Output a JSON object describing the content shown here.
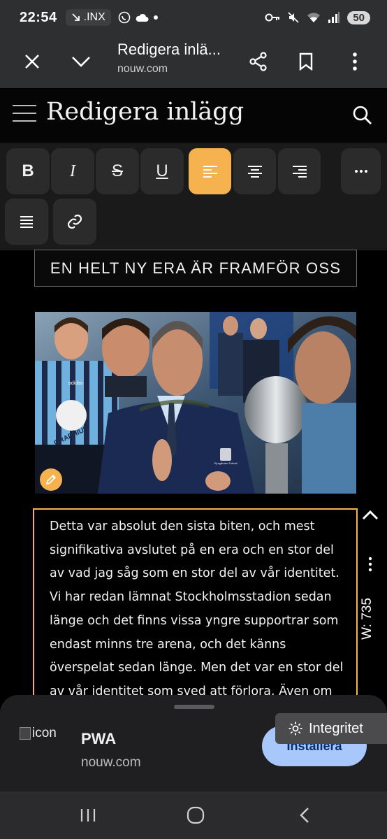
{
  "status_bar": {
    "time": "22:54",
    "carrier_tag": ".INX",
    "battery": "50",
    "icons": [
      "arrow-down-right-icon",
      "whatsapp-icon",
      "cloud-icon",
      "dot-icon",
      "key-icon",
      "mute-icon",
      "wifi-icon",
      "signal-icon"
    ]
  },
  "browser": {
    "page_title": "Redigera inlä...",
    "url": "nouw.com",
    "icons": [
      "close-icon",
      "chevron-down-icon",
      "share-icon",
      "bookmark-icon",
      "more-vert-icon"
    ]
  },
  "site_header": {
    "title": "Redigera inlägg",
    "icons": [
      "hamburger-menu-icon",
      "search-icon"
    ]
  },
  "toolbar": {
    "bold": "B",
    "italic": "I",
    "strike": "S",
    "underline": "U",
    "active_alignment": "left",
    "accent_color": "#f6b24f"
  },
  "post": {
    "headline": "EN HELT NY ERA ÄR FRAMFÖR OSS",
    "paragraph_lines": [
      "Detta var absolut den sista biten, och mest",
      "signifikativa avslutet på en era och en stor del",
      "av vad jag såg som en stor del av vår identitet.",
      "Vi har redan lämnat Stockholmsstadion sedan",
      "länge och det finns vissa yngre supportrar som",
      "endast minns tre arena, och det känns",
      "överspelat sedan länge. Men det var en stor del",
      "av vår identitet som sved att förlora. Även om"
    ],
    "image_texts": {
      "sponsor": "GRAPHIUM",
      "brand": "adidas",
      "badge": "Djurgården Fotboll",
      "engraving": "sons"
    }
  },
  "side_controls": {
    "width_label": "W: 735"
  },
  "install_sheet": {
    "icon_alt": "icon",
    "app_name": "PWA",
    "app_url": "nouw.com",
    "install_label": "Installera"
  },
  "privacy_button": {
    "label": "Integritet"
  },
  "nav_bar": {
    "icons": [
      "recents-icon",
      "home-icon",
      "back-icon"
    ]
  }
}
